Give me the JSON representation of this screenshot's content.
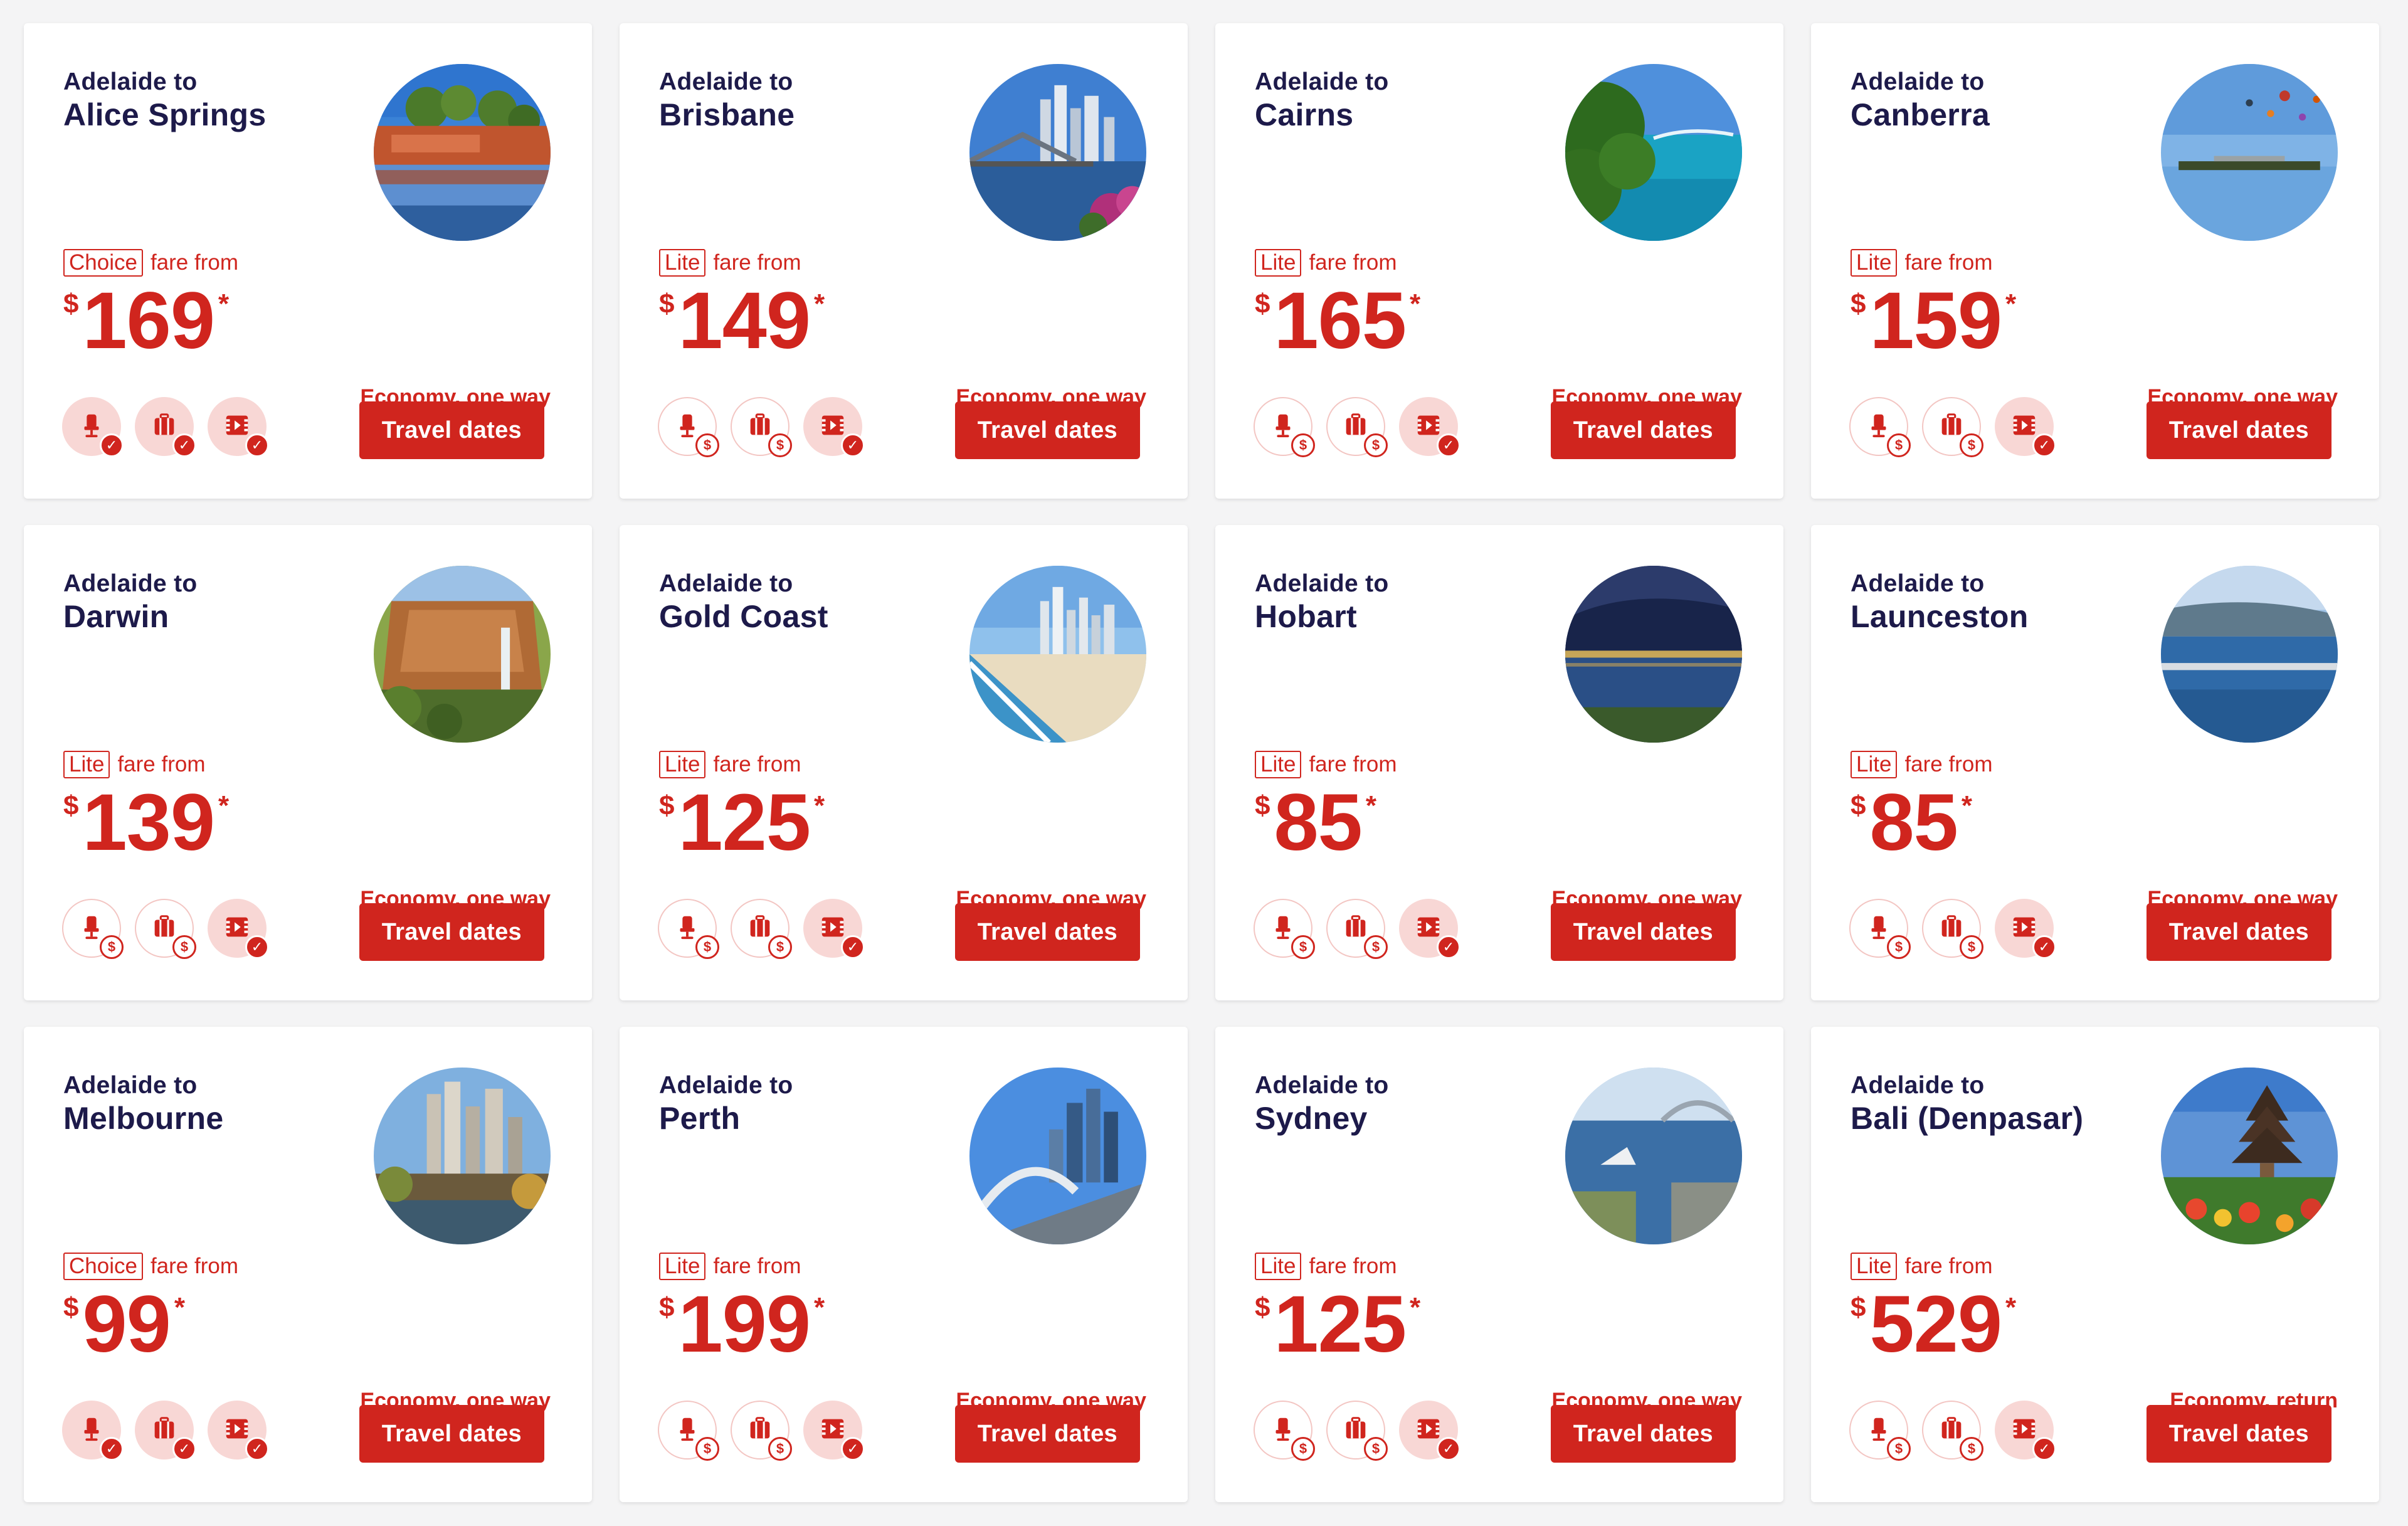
{
  "colors": {
    "brand_red": "#d0251e",
    "navy": "#1d1a4a",
    "background": "#f4f4f5"
  },
  "cards": [
    {
      "origin": "Adelaide to",
      "destination": "Alice Springs",
      "fare_type": "Choice",
      "fare_from": "fare from",
      "currency": "$",
      "price": "169",
      "asterisk": "*",
      "class_note": "Economy, one way",
      "button": "Travel dates",
      "features": [
        {
          "icon": "seat-icon",
          "status": "included"
        },
        {
          "icon": "baggage-icon",
          "status": "included"
        },
        {
          "icon": "entertainment-icon",
          "status": "included"
        }
      ],
      "photo": "outback-gorge"
    },
    {
      "origin": "Adelaide to",
      "destination": "Brisbane",
      "fare_type": "Lite",
      "fare_from": "fare from",
      "currency": "$",
      "price": "149",
      "asterisk": "*",
      "class_note": "Economy, one way",
      "button": "Travel dates",
      "features": [
        {
          "icon": "seat-icon",
          "status": "paid"
        },
        {
          "icon": "baggage-icon",
          "status": "paid"
        },
        {
          "icon": "entertainment-icon",
          "status": "included"
        }
      ],
      "photo": "city-bridge"
    },
    {
      "origin": "Adelaide to",
      "destination": "Cairns",
      "fare_type": "Lite",
      "fare_from": "fare from",
      "currency": "$",
      "price": "165",
      "asterisk": "*",
      "class_note": "Economy, one way",
      "button": "Travel dates",
      "features": [
        {
          "icon": "seat-icon",
          "status": "paid"
        },
        {
          "icon": "baggage-icon",
          "status": "paid"
        },
        {
          "icon": "entertainment-icon",
          "status": "included"
        }
      ],
      "photo": "tropical-coast"
    },
    {
      "origin": "Adelaide to",
      "destination": "Canberra",
      "fare_type": "Lite",
      "fare_from": "fare from",
      "currency": "$",
      "price": "159",
      "asterisk": "*",
      "class_note": "Economy, one way",
      "button": "Travel dates",
      "features": [
        {
          "icon": "seat-icon",
          "status": "paid"
        },
        {
          "icon": "baggage-icon",
          "status": "paid"
        },
        {
          "icon": "entertainment-icon",
          "status": "included"
        }
      ],
      "photo": "balloons-lake"
    },
    {
      "origin": "Adelaide to",
      "destination": "Darwin",
      "fare_type": "Lite",
      "fare_from": "fare from",
      "currency": "$",
      "price": "139",
      "asterisk": "*",
      "class_note": "Economy, one way",
      "button": "Travel dates",
      "features": [
        {
          "icon": "seat-icon",
          "status": "paid"
        },
        {
          "icon": "baggage-icon",
          "status": "paid"
        },
        {
          "icon": "entertainment-icon",
          "status": "included"
        }
      ],
      "photo": "waterfall-cliff"
    },
    {
      "origin": "Adelaide to",
      "destination": "Gold Coast",
      "fare_type": "Lite",
      "fare_from": "fare from",
      "currency": "$",
      "price": "125",
      "asterisk": "*",
      "class_note": "Economy, one way",
      "button": "Travel dates",
      "features": [
        {
          "icon": "seat-icon",
          "status": "paid"
        },
        {
          "icon": "baggage-icon",
          "status": "paid"
        },
        {
          "icon": "entertainment-icon",
          "status": "included"
        }
      ],
      "photo": "beach-skyline"
    },
    {
      "origin": "Adelaide to",
      "destination": "Hobart",
      "fare_type": "Lite",
      "fare_from": "fare from",
      "currency": "$",
      "price": "85",
      "asterisk": "*",
      "class_note": "Economy, one way",
      "button": "Travel dates",
      "features": [
        {
          "icon": "seat-icon",
          "status": "paid"
        },
        {
          "icon": "baggage-icon",
          "status": "paid"
        },
        {
          "icon": "entertainment-icon",
          "status": "included"
        }
      ],
      "photo": "night-harbour"
    },
    {
      "origin": "Adelaide to",
      "destination": "Launceston",
      "fare_type": "Lite",
      "fare_from": "fare from",
      "currency": "$",
      "price": "85",
      "asterisk": "*",
      "class_note": "Economy, one way",
      "button": "Travel dates",
      "features": [
        {
          "icon": "seat-icon",
          "status": "paid"
        },
        {
          "icon": "baggage-icon",
          "status": "paid"
        },
        {
          "icon": "entertainment-icon",
          "status": "included"
        }
      ],
      "photo": "river-bridge"
    },
    {
      "origin": "Adelaide to",
      "destination": "Melbourne",
      "fare_type": "Choice",
      "fare_from": "fare from",
      "currency": "$",
      "price": "99",
      "asterisk": "*",
      "class_note": "Economy, one way",
      "button": "Travel dates",
      "features": [
        {
          "icon": "seat-icon",
          "status": "included"
        },
        {
          "icon": "baggage-icon",
          "status": "included"
        },
        {
          "icon": "entertainment-icon",
          "status": "included"
        }
      ],
      "photo": "city-river"
    },
    {
      "origin": "Adelaide to",
      "destination": "Perth",
      "fare_type": "Lite",
      "fare_from": "fare from",
      "currency": "$",
      "price": "199",
      "asterisk": "*",
      "class_note": "Economy, one way",
      "button": "Travel dates",
      "features": [
        {
          "icon": "seat-icon",
          "status": "paid"
        },
        {
          "icon": "baggage-icon",
          "status": "paid"
        },
        {
          "icon": "entertainment-icon",
          "status": "included"
        }
      ],
      "photo": "skyline-bridge"
    },
    {
      "origin": "Adelaide to",
      "destination": "Sydney",
      "fare_type": "Lite",
      "fare_from": "fare from",
      "currency": "$",
      "price": "125",
      "asterisk": "*",
      "class_note": "Economy, one way",
      "button": "Travel dates",
      "features": [
        {
          "icon": "seat-icon",
          "status": "paid"
        },
        {
          "icon": "baggage-icon",
          "status": "paid"
        },
        {
          "icon": "entertainment-icon",
          "status": "included"
        }
      ],
      "photo": "harbour-aerial"
    },
    {
      "origin": "Adelaide to",
      "destination": "Bali (Denpasar)",
      "fare_type": "Lite",
      "fare_from": "fare from",
      "currency": "$",
      "price": "529",
      "asterisk": "*",
      "class_note": "Economy, return",
      "button": "Travel dates",
      "features": [
        {
          "icon": "seat-icon",
          "status": "paid"
        },
        {
          "icon": "baggage-icon",
          "status": "paid"
        },
        {
          "icon": "entertainment-icon",
          "status": "included"
        }
      ],
      "photo": "temple-garden"
    }
  ]
}
